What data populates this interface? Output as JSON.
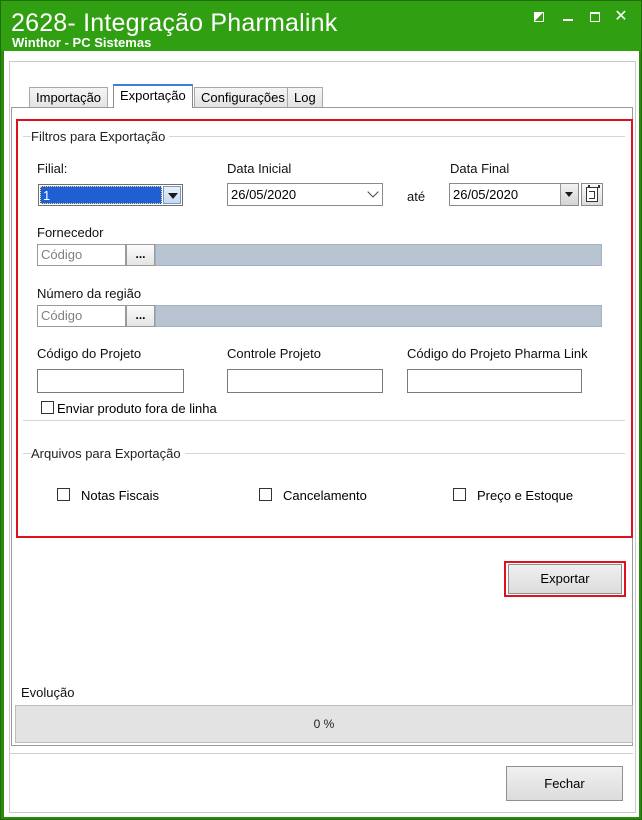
{
  "window": {
    "title": "2628- Integração Pharmalink",
    "subtitle": "Winthor - PC Sistemas"
  },
  "tabs": [
    {
      "label": "Importação",
      "active": false
    },
    {
      "label": "Exportação",
      "active": true
    },
    {
      "label": "Configurações",
      "active": false
    },
    {
      "label": "Log",
      "active": false
    }
  ],
  "filters": {
    "group_title": "Filtros para Exportação",
    "filial": {
      "label": "Filial:",
      "value": "1"
    },
    "data_inicial": {
      "label": "Data Inicial",
      "value": "26/05/2020"
    },
    "ate_label": "até",
    "data_final": {
      "label": "Data Final",
      "value": "26/05/2020"
    },
    "fornecedor": {
      "label": "Fornecedor",
      "code_placeholder": "Código",
      "lookup_label": "...",
      "description": ""
    },
    "regiao": {
      "label": "Número da região",
      "code_placeholder": "Código",
      "lookup_label": "...",
      "description": ""
    },
    "codigo_projeto": {
      "label": "Código do Projeto",
      "value": ""
    },
    "controle_projeto": {
      "label": "Controle Projeto",
      "value": ""
    },
    "codigo_pharmalink": {
      "label": "Código do Projeto Pharma Link",
      "value": ""
    },
    "fora_linha": {
      "label": "Enviar produto fora de linha",
      "checked": false
    }
  },
  "arquivos": {
    "group_title": "Arquivos para Exportação",
    "notas_fiscais": {
      "label": "Notas Fiscais",
      "checked": false
    },
    "cancelamento": {
      "label": "Cancelamento",
      "checked": false
    },
    "preco_estoque": {
      "label": "Preço e Estoque",
      "checked": false
    }
  },
  "actions": {
    "exportar_label": "Exportar",
    "fechar_label": "Fechar"
  },
  "progress": {
    "label": "Evolução",
    "text": "0 %",
    "fraction": 0
  },
  "colors": {
    "titlebar": "#30a012",
    "highlight": "#e0101e",
    "selection": "#1f5fd3",
    "lookup_description": "#b8c4d2"
  }
}
